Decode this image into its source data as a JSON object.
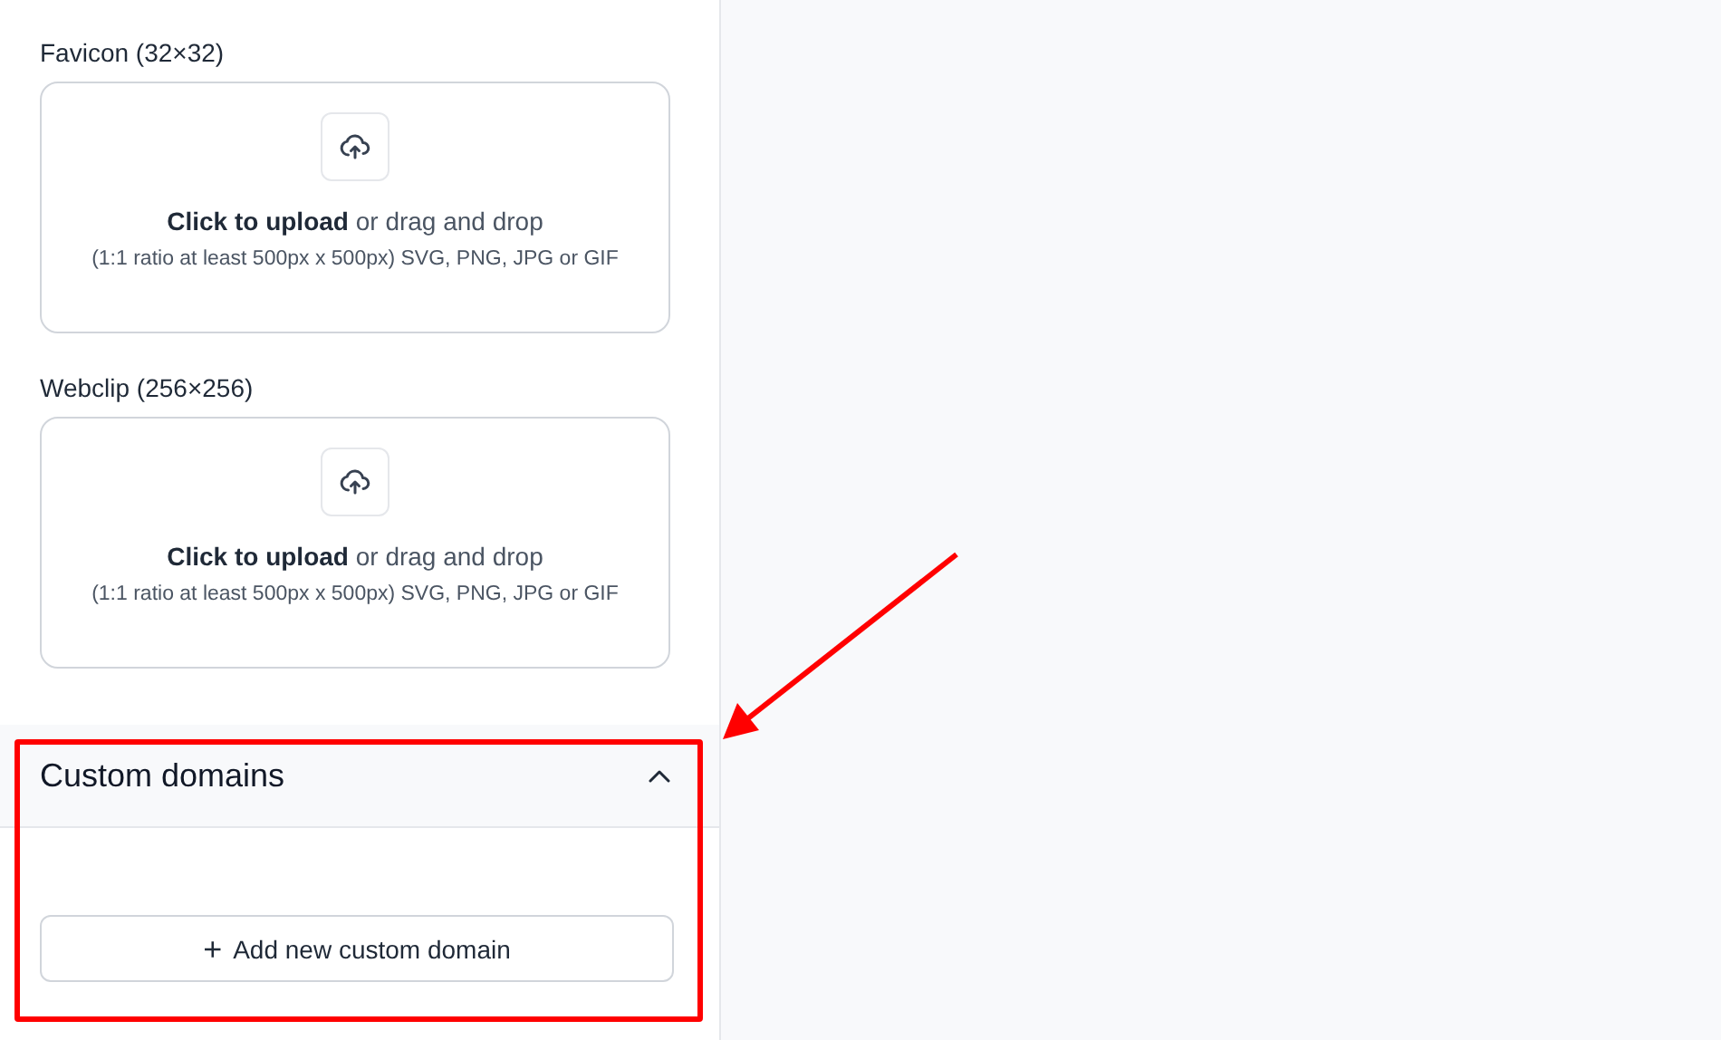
{
  "uploads": [
    {
      "label": "Favicon (32×32)",
      "prompt": "**Click to upload** or drag and drop",
      "hint": "(1:1 ratio at least 500px x 500px) SVG, PNG, JPG or GIF"
    },
    {
      "label": "Webclip (256×256)",
      "prompt": "**Click to upload** or drag and drop",
      "hint": "(1:1 ratio at least 500px x 500px) SVG, PNG, JPG or GIF"
    }
  ],
  "section": {
    "title": "Custom domains",
    "expanded": true,
    "button": {
      "icon": "+",
      "label": "Add new custom domain"
    }
  }
}
